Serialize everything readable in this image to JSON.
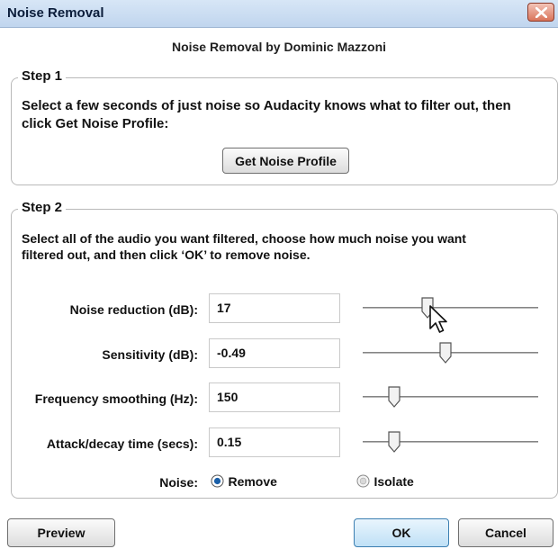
{
  "window": {
    "title": "Noise Removal"
  },
  "header": {
    "subtitle": "Noise Removal by Dominic Mazzoni"
  },
  "step1": {
    "legend": "Step 1",
    "description": "Select a few seconds of just noise so Audacity knows what to filter out, then click Get Noise Profile:",
    "button_label": "Get Noise Profile"
  },
  "step2": {
    "legend": "Step 2",
    "description": "Select all of the audio you want filtered, choose how much noise you want filtered out, and then click ‘OK’ to remove noise.",
    "rows": [
      {
        "label": "Noise reduction (dB):",
        "value": "17",
        "slider_fraction": 0.37
      },
      {
        "label": "Sensitivity (dB):",
        "value": "-0.49",
        "slider_fraction": 0.47
      },
      {
        "label": "Frequency smoothing (Hz):",
        "value": "150",
        "slider_fraction": 0.18
      },
      {
        "label": "Attack/decay time (secs):",
        "value": "0.15",
        "slider_fraction": 0.18
      }
    ],
    "noise": {
      "label": "Noise:",
      "options": [
        {
          "label": "Remove",
          "selected": true
        },
        {
          "label": "Isolate",
          "selected": false
        }
      ]
    }
  },
  "footer": {
    "preview_label": "Preview",
    "ok_label": "OK",
    "cancel_label": "Cancel"
  },
  "colors": {
    "titlebar": "#c9dcf1",
    "close_button": "#d9745a",
    "ok_button": "#bfe0f6",
    "radio_selected": "#1a5fa8"
  },
  "icons": {
    "close": "close-icon",
    "cursor": "mouse-pointer-icon"
  }
}
